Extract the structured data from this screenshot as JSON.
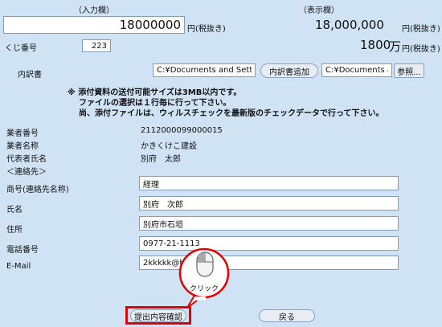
{
  "input_label": "（入力欄）",
  "display_label": "（表示欄）",
  "amount": {
    "value": "18000000",
    "unit": "円(税抜き)",
    "display_value": "18,000,000",
    "display_unit": "円(税抜き)",
    "man_value": "1800",
    "man_unit": "万",
    "man_suffix": "円(税抜き)"
  },
  "lot": {
    "label": "くじ番号",
    "value": "223"
  },
  "breakdown": {
    "label": "内訳書",
    "file1": "C:¥Documents and Settings¥",
    "add_button": "内訳書追加",
    "file2": "C:¥Documents and",
    "browse_button": "参照..."
  },
  "notes": [
    "※ 添付資料の送付可能サイズは3MB以内です。",
    "ファイルの選択は１行毎に行って下さい。",
    "尚、添付ファイルは、ウィルスチェックを最新版のチェックデータで行って下さい。"
  ],
  "company": {
    "id_label": "業者番号",
    "id_value": "2112000099000015",
    "name_label": "業者名称",
    "name_value": "かきくけこ建設",
    "rep_label": "代表者氏名",
    "rep_value": "別府　太郎",
    "contact_heading": "＜連絡先＞"
  },
  "contact": {
    "trade_label": "商号(連絡先名称)",
    "trade_value": "経理",
    "name_label": "氏名",
    "name_value": "別府　次郎",
    "address_label": "住所",
    "address_value": "別府市石垣",
    "phone_label": "電話番号",
    "phone_value": "0977-21-1113",
    "email_label": "E-Mail",
    "email_value": "2kkkkk@ha"
  },
  "callout_text": "クリック",
  "buttons": {
    "confirm": "提出内容確認",
    "back": "戻る"
  },
  "colors": {
    "background": "#cfe3f5",
    "highlight": "#e60000"
  }
}
